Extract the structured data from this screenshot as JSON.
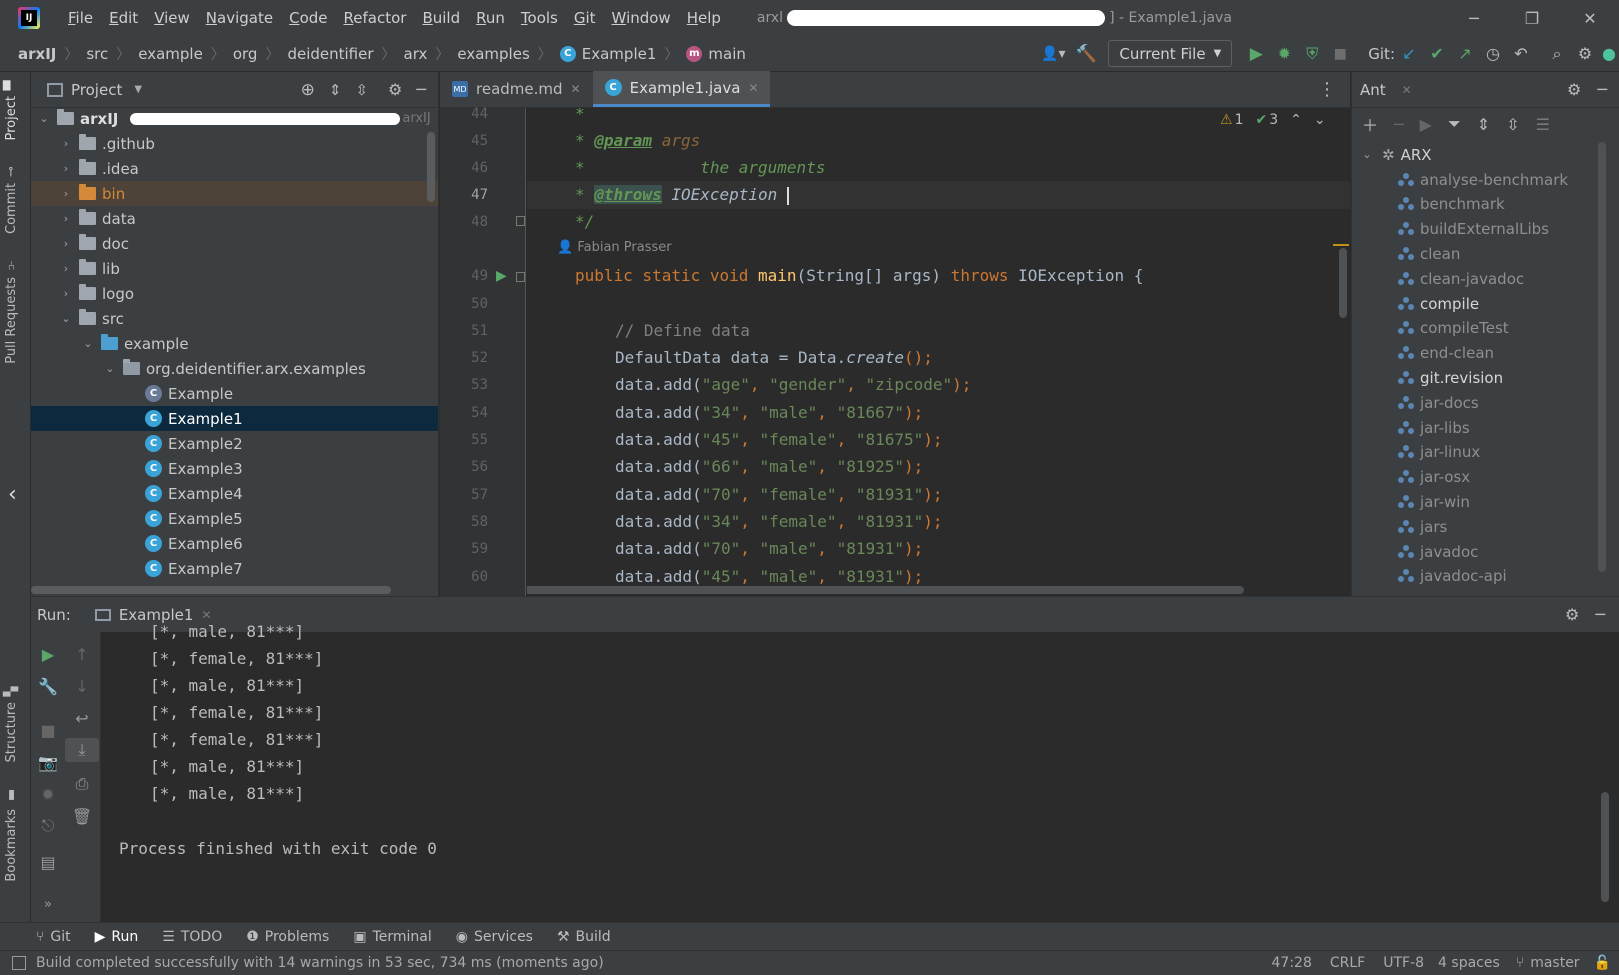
{
  "menu": [
    "File",
    "Edit",
    "View",
    "Navigate",
    "Code",
    "Refactor",
    "Build",
    "Run",
    "Tools",
    "Git",
    "Window",
    "Help"
  ],
  "title": {
    "prefix": "arxl",
    "suffix": "] - Example1.java"
  },
  "breadcrumbs": [
    "arxIJ",
    "src",
    "example",
    "org",
    "deidentifier",
    "arx",
    "examples",
    "Example1",
    "main"
  ],
  "toolbar": {
    "run_config": "Current File",
    "git_label": "Git:"
  },
  "project": {
    "title": "Project",
    "root": "arxIJ",
    "root_suffix": "arxIJ",
    "items": [
      {
        "label": ".github"
      },
      {
        "label": ".idea"
      },
      {
        "label": "bin"
      },
      {
        "label": "data"
      },
      {
        "label": "doc"
      },
      {
        "label": "lib"
      },
      {
        "label": "logo"
      },
      {
        "label": "src"
      },
      {
        "label": "example"
      },
      {
        "label": "org.deidentifier.arx.examples"
      },
      {
        "label": "Example"
      },
      {
        "label": "Example1"
      },
      {
        "label": "Example2"
      },
      {
        "label": "Example3"
      },
      {
        "label": "Example4"
      },
      {
        "label": "Example5"
      },
      {
        "label": "Example6"
      },
      {
        "label": "Example7"
      }
    ]
  },
  "editor": {
    "tabs": [
      {
        "label": "readme.md"
      },
      {
        "label": "Example1.java"
      }
    ],
    "inspections": {
      "warnings": "1",
      "weak": "3"
    },
    "author": "Fabian Prasser",
    "line_numbers": [
      "44",
      "45",
      "46",
      "47",
      "48",
      "49",
      "50",
      "51",
      "52",
      "53",
      "54",
      "55",
      "56",
      "57",
      "58",
      "59",
      "60"
    ],
    "code": {
      "c44": "*",
      "c45a": "* ",
      "c45b": "@param",
      "c45c": " args",
      "c46": "*            the arguments",
      "c47a": "* ",
      "c47b": "@throws",
      "c47c": " IOException ",
      "c48": "*/",
      "c49a": "public static void ",
      "c49b": "main",
      "c49c": "(String[] args) ",
      "c49d": "throws",
      "c49e": " IOException {",
      "c51": "// Define data",
      "c52a": "DefaultData data = Data.",
      "c52b": "create",
      "c52c": "();",
      "rows": [
        [
          "\"age\"",
          "\"gender\"",
          "\"zipcode\""
        ],
        [
          "\"34\"",
          "\"male\"",
          "\"81667\""
        ],
        [
          "\"45\"",
          "\"female\"",
          "\"81675\""
        ],
        [
          "\"66\"",
          "\"male\"",
          "\"81925\""
        ],
        [
          "\"70\"",
          "\"female\"",
          "\"81931\""
        ],
        [
          "\"34\"",
          "\"female\"",
          "\"81931\""
        ],
        [
          "\"70\"",
          "\"male\"",
          "\"81931\""
        ],
        [
          "\"45\"",
          "\"male\"",
          "\"81931\""
        ]
      ],
      "call": "data.add(",
      "comma": ", ",
      "end": ");"
    }
  },
  "ant": {
    "title": "Ant",
    "root": "ARX",
    "targets": [
      {
        "label": "analyse-benchmark",
        "bright": false
      },
      {
        "label": "benchmark",
        "bright": false
      },
      {
        "label": "buildExternalLibs",
        "bright": false
      },
      {
        "label": "clean",
        "bright": false
      },
      {
        "label": "clean-javadoc",
        "bright": false
      },
      {
        "label": "compile",
        "bright": true
      },
      {
        "label": "compileTest",
        "bright": false
      },
      {
        "label": "end-clean",
        "bright": false
      },
      {
        "label": "git.revision",
        "bright": true
      },
      {
        "label": "jar-docs",
        "bright": false
      },
      {
        "label": "jar-libs",
        "bright": false
      },
      {
        "label": "jar-linux",
        "bright": false
      },
      {
        "label": "jar-osx",
        "bright": false
      },
      {
        "label": "jar-win",
        "bright": false
      },
      {
        "label": "jars",
        "bright": false
      },
      {
        "label": "javadoc",
        "bright": false
      },
      {
        "label": "javadoc-api",
        "bright": false
      }
    ]
  },
  "run": {
    "label": "Run:",
    "tab": "Example1",
    "output": [
      "[*, male, 81***]",
      "[*, female, 81***]",
      "[*, male, 81***]",
      "[*, female, 81***]",
      "[*, female, 81***]",
      "[*, male, 81***]",
      "[*, male, 81***]"
    ],
    "finished": "Process finished with exit code 0"
  },
  "side_tabs": {
    "project": "Project",
    "commit": "Commit",
    "pull": "Pull Requests",
    "structure": "Structure",
    "bookmarks": "Bookmarks"
  },
  "tool_tabs": [
    "Git",
    "Run",
    "TODO",
    "Problems",
    "Terminal",
    "Services",
    "Build"
  ],
  "status": {
    "message": "Build completed successfully with 14 warnings in 53 sec, 734 ms (moments ago)",
    "position": "47:28",
    "line_sep": "CRLF",
    "encoding": "UTF-8",
    "indent": "4 spaces",
    "branch": "master"
  }
}
